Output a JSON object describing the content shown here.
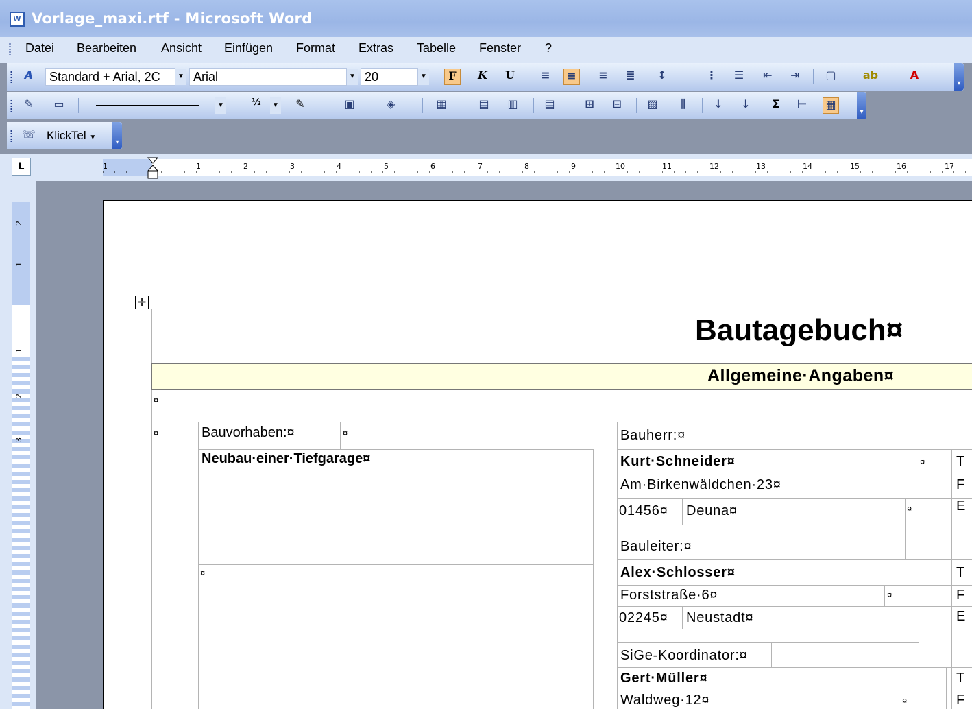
{
  "window": {
    "title": "Vorlage_maxi.rtf - Microsoft Word",
    "app_icon_label": "W"
  },
  "menu": [
    {
      "label": "Datei"
    },
    {
      "label": "Bearbeiten"
    },
    {
      "label": "Ansicht"
    },
    {
      "label": "Einfügen"
    },
    {
      "label": "Format"
    },
    {
      "label": "Extras"
    },
    {
      "label": "Tabelle"
    },
    {
      "label": "Fenster"
    },
    {
      "label": "?"
    }
  ],
  "formatting": {
    "style": "Standard + Arial, 2C",
    "font": "Arial",
    "size": "20",
    "bold": "F",
    "italic": "K",
    "underline": "U",
    "active_alignment": "center"
  },
  "drawing_toolbar": {
    "line_weight": "½"
  },
  "klicktel": {
    "label": "KlickTel"
  },
  "ruler": {
    "tab_selector": "L",
    "h_numbers": [
      "1",
      "1",
      "2",
      "3",
      "4",
      "5",
      "6",
      "7",
      "8",
      "9",
      "10",
      "11",
      "12",
      "13",
      "14",
      "15",
      "16",
      "17"
    ],
    "v_numbers": [
      "2",
      "1",
      "1",
      "2",
      "3"
    ]
  },
  "document": {
    "heading": "Bautagebuch¤",
    "section": "Allgemeine·Angaben¤",
    "project_label": "Bauvorhaben:¤",
    "project_name": "Neubau·einer·Tiefgarage¤",
    "client_label": "Bauherr:¤",
    "client_name": "Kurt·Schneider¤",
    "client_street": "Am·Birkenwäldchen·23¤",
    "client_zip": "01456¤",
    "client_city": "Deuna¤",
    "manager_label": "Bauleiter:¤",
    "manager_name": "Alex·Schlosser¤",
    "manager_street": "Forststraße·6¤",
    "manager_zip": "02245¤",
    "manager_city": "Neustadt¤",
    "sige_label": "SiGe-Koordinator:¤",
    "sige_name": "Gert·Müller¤",
    "sige_street": "Waldweg·12¤",
    "cell_mark": "¤",
    "right_col_T": "T",
    "right_col_F": "F",
    "right_col_E": "E"
  }
}
